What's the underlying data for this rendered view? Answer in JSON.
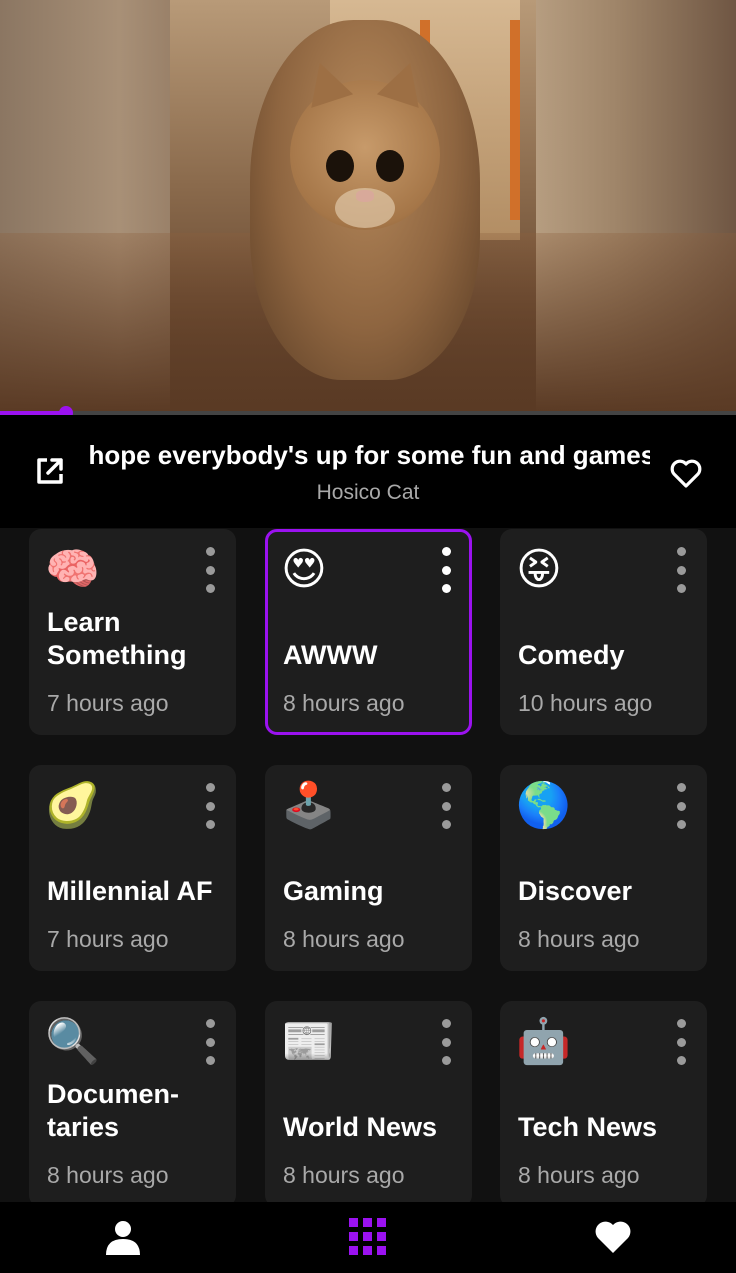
{
  "player": {
    "title": "I hope everybody's up for some fun and games",
    "channel": "Hosico Cat",
    "progress_fraction": 0.09,
    "accent_color": "#9b12f0"
  },
  "categories": [
    {
      "emoji": "🧠",
      "icon": "brain-icon",
      "name": "Learn Something",
      "time": "7 hours ago",
      "selected": false
    },
    {
      "emoji": "😍",
      "icon": "heart-eyes-icon",
      "name": "AWWW",
      "time": "8 hours ago",
      "selected": true
    },
    {
      "emoji": "😝",
      "icon": "tongue-face-icon",
      "name": "Comedy",
      "time": "10 hours ago",
      "selected": false
    },
    {
      "emoji": "🥑",
      "icon": "avocado-icon",
      "name": "Millennial AF",
      "time": "7 hours ago",
      "selected": false
    },
    {
      "emoji": "🕹️",
      "icon": "joystick-icon",
      "name": "Gaming",
      "time": "8 hours ago",
      "selected": false
    },
    {
      "emoji": "🌎",
      "icon": "globe-icon",
      "name": "Discover",
      "time": "8 hours ago",
      "selected": false
    },
    {
      "emoji": "🔍",
      "icon": "magnifier-icon",
      "name": "Documen-taries",
      "time": "8 hours ago",
      "selected": false
    },
    {
      "emoji": "📰",
      "icon": "newspaper-icon",
      "name": "World News",
      "time": "8 hours ago",
      "selected": false
    },
    {
      "emoji": "🤖",
      "icon": "robot-icon",
      "name": "Tech News",
      "time": "8 hours ago",
      "selected": false
    }
  ],
  "nav": {
    "items": [
      {
        "icon": "profile-icon",
        "active": false
      },
      {
        "icon": "grid-icon",
        "active": true
      },
      {
        "icon": "heart-icon",
        "active": false
      }
    ]
  }
}
